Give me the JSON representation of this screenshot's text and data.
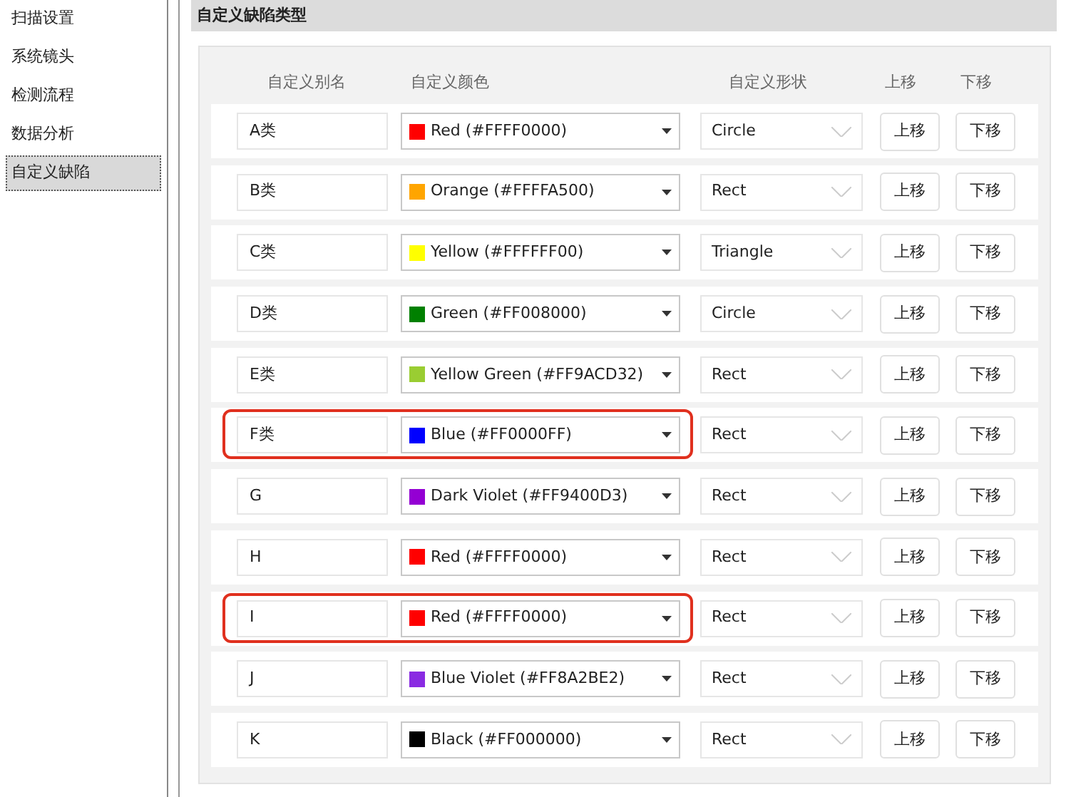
{
  "sidebar": {
    "items": [
      {
        "label": "扫描设置",
        "selected": false
      },
      {
        "label": "系统镜头",
        "selected": false
      },
      {
        "label": "检测流程",
        "selected": false
      },
      {
        "label": "数据分析",
        "selected": false
      },
      {
        "label": "自定义缺陷",
        "selected": true
      }
    ]
  },
  "panel": {
    "title": "自定义缺陷类型"
  },
  "table": {
    "columns": [
      "自定义别名",
      "自定义颜色",
      "自定义形状",
      "上移",
      "下移"
    ],
    "rows": [
      {
        "alias": "A类",
        "color_name": "Red (#FFFF0000)",
        "color": "#ff0000",
        "shape": "Circle",
        "up": "上移",
        "down": "下移",
        "highlighted": false
      },
      {
        "alias": "B类",
        "color_name": "Orange (#FFFFA500)",
        "color": "#ffa500",
        "shape": "Rect",
        "up": "上移",
        "down": "下移",
        "highlighted": false
      },
      {
        "alias": "C类",
        "color_name": "Yellow (#FFFFFF00)",
        "color": "#ffff00",
        "shape": "Triangle",
        "up": "上移",
        "down": "下移",
        "highlighted": false
      },
      {
        "alias": "D类",
        "color_name": "Green (#FF008000)",
        "color": "#008000",
        "shape": "Circle",
        "up": "上移",
        "down": "下移",
        "highlighted": false
      },
      {
        "alias": "E类",
        "color_name": "Yellow Green (#FF9ACD32)",
        "color": "#9acd32",
        "shape": "Rect",
        "up": "上移",
        "down": "下移",
        "highlighted": false
      },
      {
        "alias": "F类",
        "color_name": "Blue (#FF0000FF)",
        "color": "#0000ff",
        "shape": "Rect",
        "up": "上移",
        "down": "下移",
        "highlighted": true
      },
      {
        "alias": "G",
        "color_name": "Dark Violet (#FF9400D3)",
        "color": "#9400d3",
        "shape": "Rect",
        "up": "上移",
        "down": "下移",
        "highlighted": false
      },
      {
        "alias": "H",
        "color_name": "Red (#FFFF0000)",
        "color": "#ff0000",
        "shape": "Rect",
        "up": "上移",
        "down": "下移",
        "highlighted": false
      },
      {
        "alias": "I",
        "color_name": "Red (#FFFF0000)",
        "color": "#ff0000",
        "shape": "Rect",
        "up": "上移",
        "down": "下移",
        "highlighted": true
      },
      {
        "alias": "J",
        "color_name": "Blue Violet (#FF8A2BE2)",
        "color": "#8a2be2",
        "shape": "Rect",
        "up": "上移",
        "down": "下移",
        "highlighted": false
      },
      {
        "alias": "K",
        "color_name": "Black (#FF000000)",
        "color": "#000000",
        "shape": "Rect",
        "up": "上移",
        "down": "下移",
        "highlighted": false
      }
    ]
  }
}
